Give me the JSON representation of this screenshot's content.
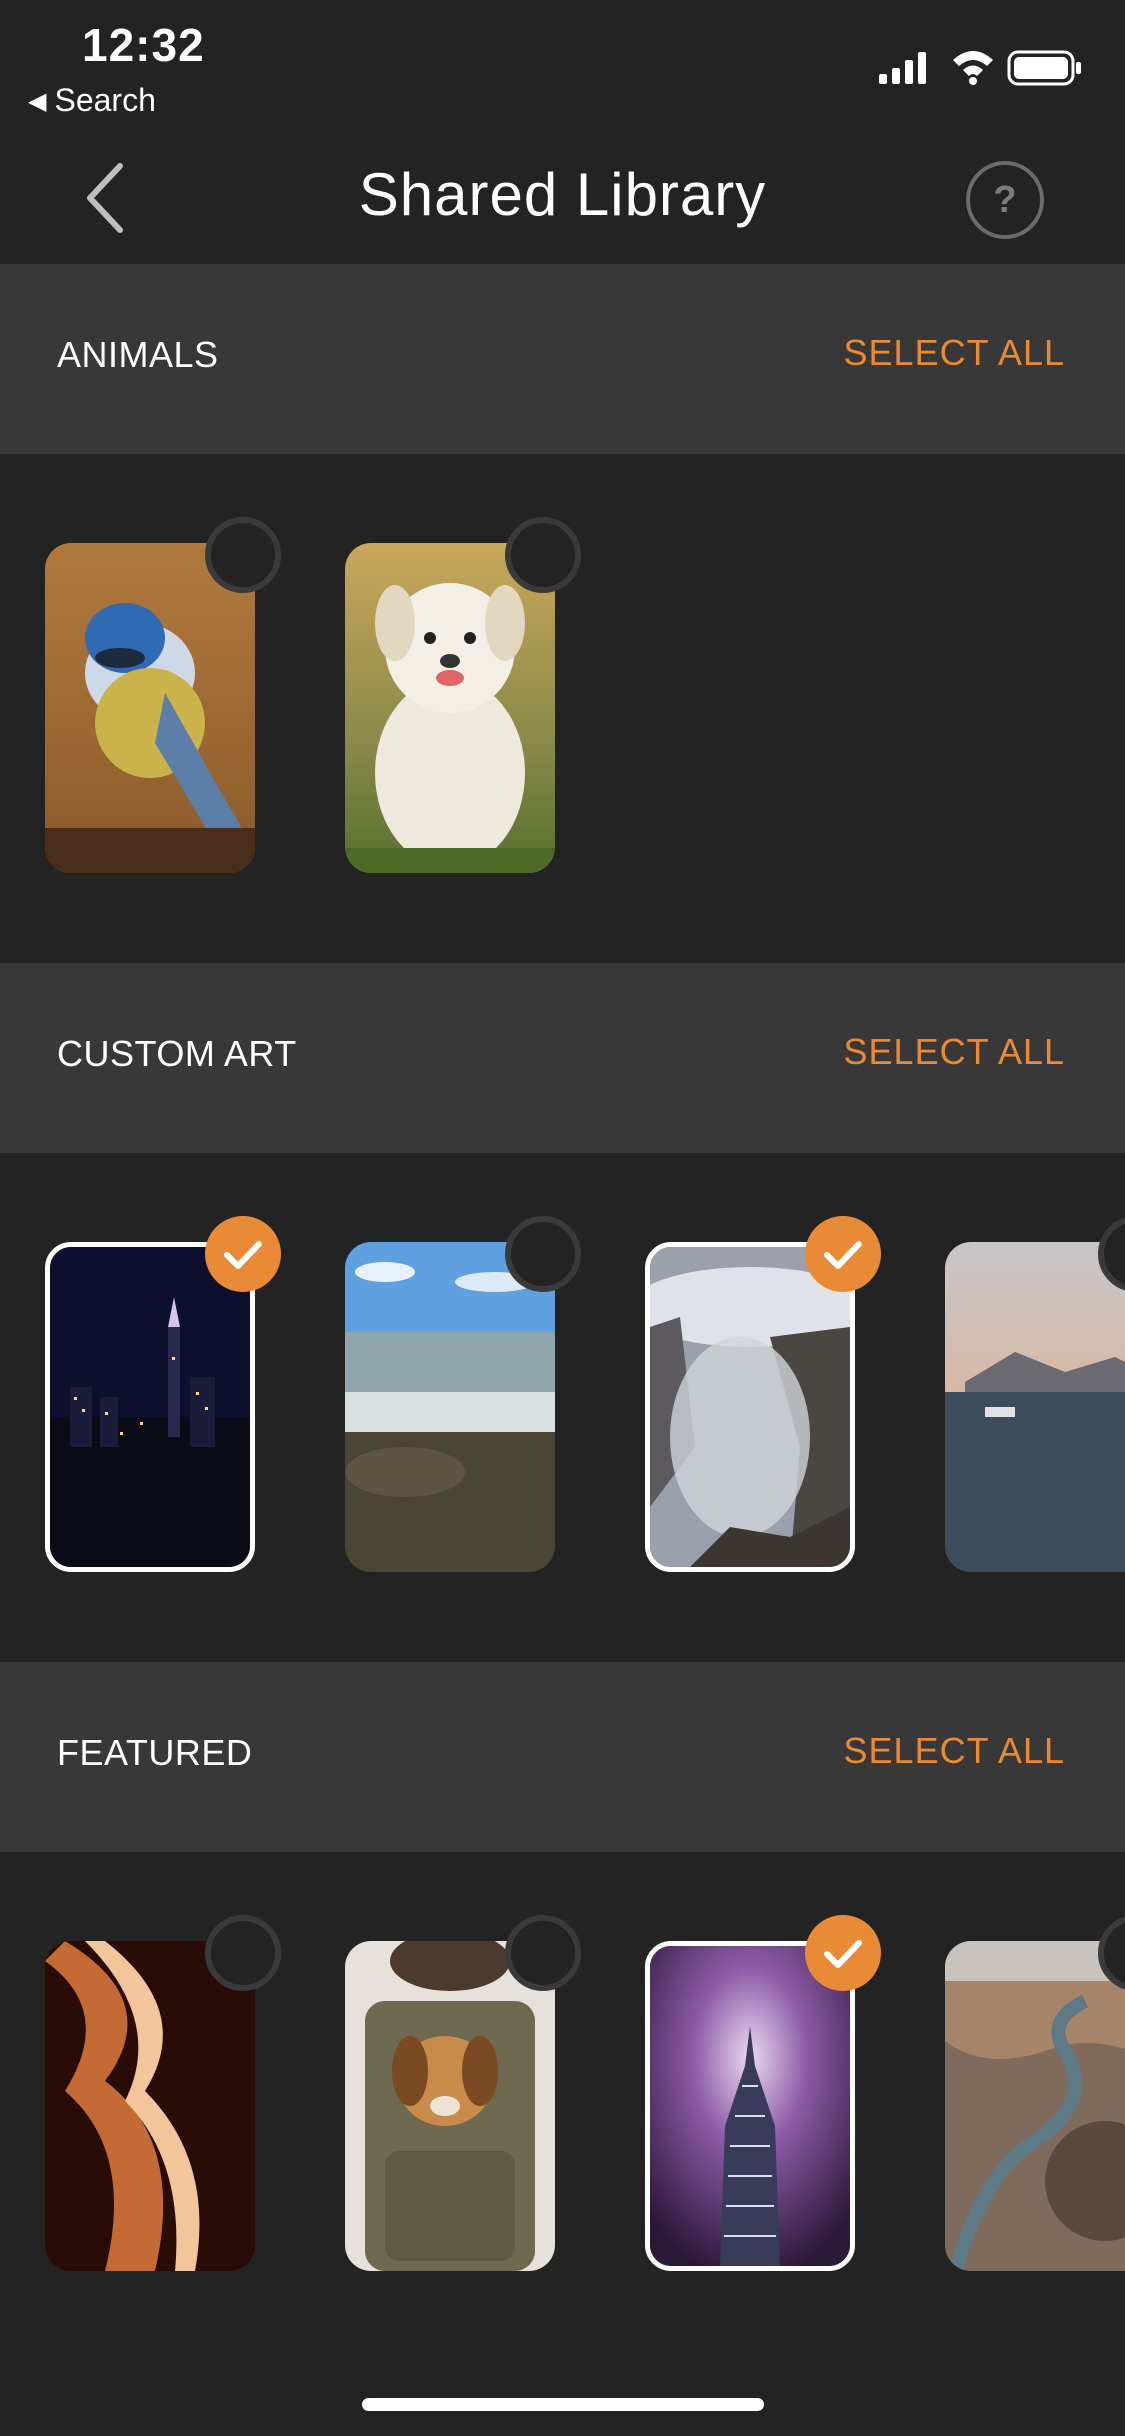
{
  "status_bar": {
    "time": "12:32",
    "back_app": "Search"
  },
  "nav": {
    "title": "Shared Library",
    "help_label": "?"
  },
  "sections": [
    {
      "title": "ANIMALS",
      "select_all": "SELECT ALL"
    },
    {
      "title": "CUSTOM ART",
      "select_all": "SELECT ALL"
    },
    {
      "title": "FEATURED",
      "select_all": "SELECT ALL"
    }
  ],
  "thumbnails": {
    "animals": [
      {
        "subject": "blue-tit-bird",
        "selected": false
      },
      {
        "subject": "white-puppy",
        "selected": false
      }
    ],
    "custom_art": [
      {
        "subject": "city-skyline-night",
        "selected": true
      },
      {
        "subject": "ocean-rocky-shore",
        "selected": false
      },
      {
        "subject": "misty-cliffs",
        "selected": true
      },
      {
        "subject": "bay-with-boat",
        "selected": false
      }
    ],
    "featured": [
      {
        "subject": "canyon-rock",
        "selected": false
      },
      {
        "subject": "puppy-in-backpack",
        "selected": false
      },
      {
        "subject": "skyscraper-fog",
        "selected": true
      },
      {
        "subject": "river-canyon",
        "selected": false
      }
    ]
  },
  "colors": {
    "accent": "#e88a36",
    "background": "#232323",
    "header_bg": "#383838"
  }
}
